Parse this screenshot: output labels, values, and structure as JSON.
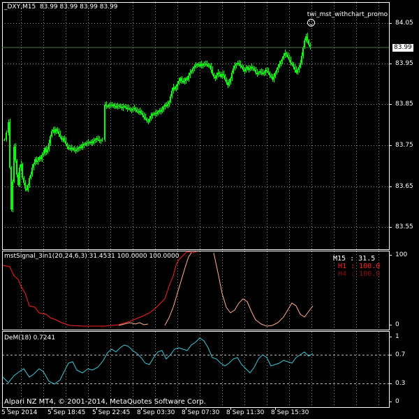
{
  "header": {
    "symbol_info": "_DXY,M15  83.99 83.99 83.99 83.99",
    "ea_label": "twi_mst_withchart_promo",
    "smiley_icon": "smiley-icon"
  },
  "current_price": "83.99",
  "main_axis": {
    "ticks": [
      "84.05",
      "83.95",
      "83.85",
      "83.75",
      "83.65",
      "83.55"
    ]
  },
  "signal_panel": {
    "label": "mstSignal_3in1(20,24,6,3) 31.4531 100.0000 100.0000",
    "axis_ticks": [
      "100",
      "0"
    ],
    "readouts": [
      {
        "tf": "M15",
        "sep": ":",
        "value": "31.5",
        "color": "#ffffff"
      },
      {
        "tf": "H1",
        "sep": ":",
        "value": "100.0",
        "color": "#ff2020"
      },
      {
        "tf": "H4",
        "sep": ":",
        "value": "100.0",
        "color": "#8a1010"
      }
    ]
  },
  "dem_panel": {
    "label": "DeM(18) 0.7241",
    "axis_ticks": [
      "1",
      "0.7",
      "0.3",
      "0"
    ]
  },
  "copyright": "Alpari NZ MT4, © 2001-2014, MetaQuotes Software Corp.",
  "time_axis": {
    "labels": [
      "5 Sep 2014",
      "5 Sep 18:45",
      "5 Sep 22:45",
      "8 Sep 03:30",
      "8 Sep 07:30",
      "8 Sep 11:30",
      "8 Sep 15:30"
    ]
  },
  "colors": {
    "bull": "#00ff00",
    "signal_red": "#ff2020",
    "signal_orange": "#ffb090",
    "dem_line": "#3fc8d8",
    "grid": "#ffffff"
  }
}
